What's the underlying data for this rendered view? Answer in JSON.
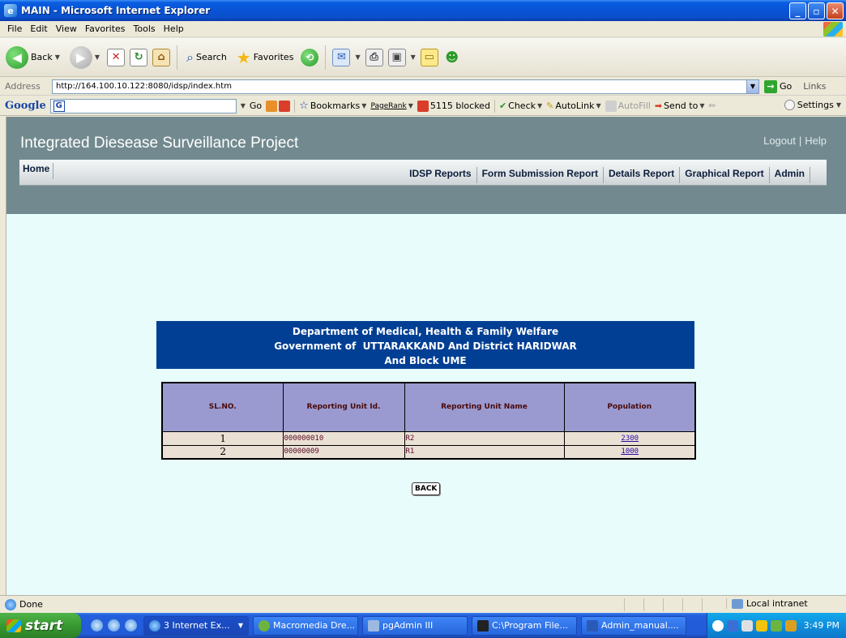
{
  "window": {
    "title": "MAIN - Microsoft Internet Explorer"
  },
  "menu": [
    "File",
    "Edit",
    "View",
    "Favorites",
    "Tools",
    "Help"
  ],
  "toolbar": {
    "back": "Back",
    "search": "Search",
    "favorites": "Favorites"
  },
  "address": {
    "label": "Address",
    "url": "http://164.100.10.122:8080/idsp/index.htm",
    "go": "Go",
    "links": "Links"
  },
  "googlebar": {
    "logo": "Google",
    "go": "Go",
    "bookmarks": "Bookmarks",
    "pagerank": "PageRank",
    "blocked": "5115 blocked",
    "check": "Check",
    "autolink": "AutoLink",
    "autofill": "AutoFill",
    "sendto": "Send to",
    "settings": "Settings"
  },
  "site": {
    "title": "Integrated Diesease Surveillance Project",
    "logout": "Logout",
    "help": "Help",
    "nav": {
      "home": "Home",
      "items": [
        "IDSP Reports",
        "Form Submission Report",
        "Details Report",
        "Graphical Report",
        "Admin"
      ]
    }
  },
  "banner": {
    "line1": "Department of Medical, Health & Family Welfare",
    "line2": "Government of  UTTARAKKAND And District HARIDWAR",
    "line3": "And Block UME"
  },
  "table": {
    "headers": [
      "SL.NO.",
      "Reporting Unit Id.",
      "Reporting Unit Name",
      "Population"
    ],
    "rows": [
      {
        "sl": "1",
        "unit_id": "000000010",
        "unit_name": "R2",
        "population": "2300"
      },
      {
        "sl": "2",
        "unit_id": "00000009",
        "unit_name": "R1",
        "population": "1000"
      }
    ]
  },
  "back_button": "BACK",
  "status": {
    "text": "Done",
    "zone": "Local intranet"
  },
  "taskbar": {
    "start": "start",
    "tasks": [
      "3 Internet Ex...",
      "Macromedia Dre...",
      "pgAdmin III",
      "C:\\Program File...",
      "Admin_manual...."
    ],
    "clock": "3:49 PM"
  }
}
